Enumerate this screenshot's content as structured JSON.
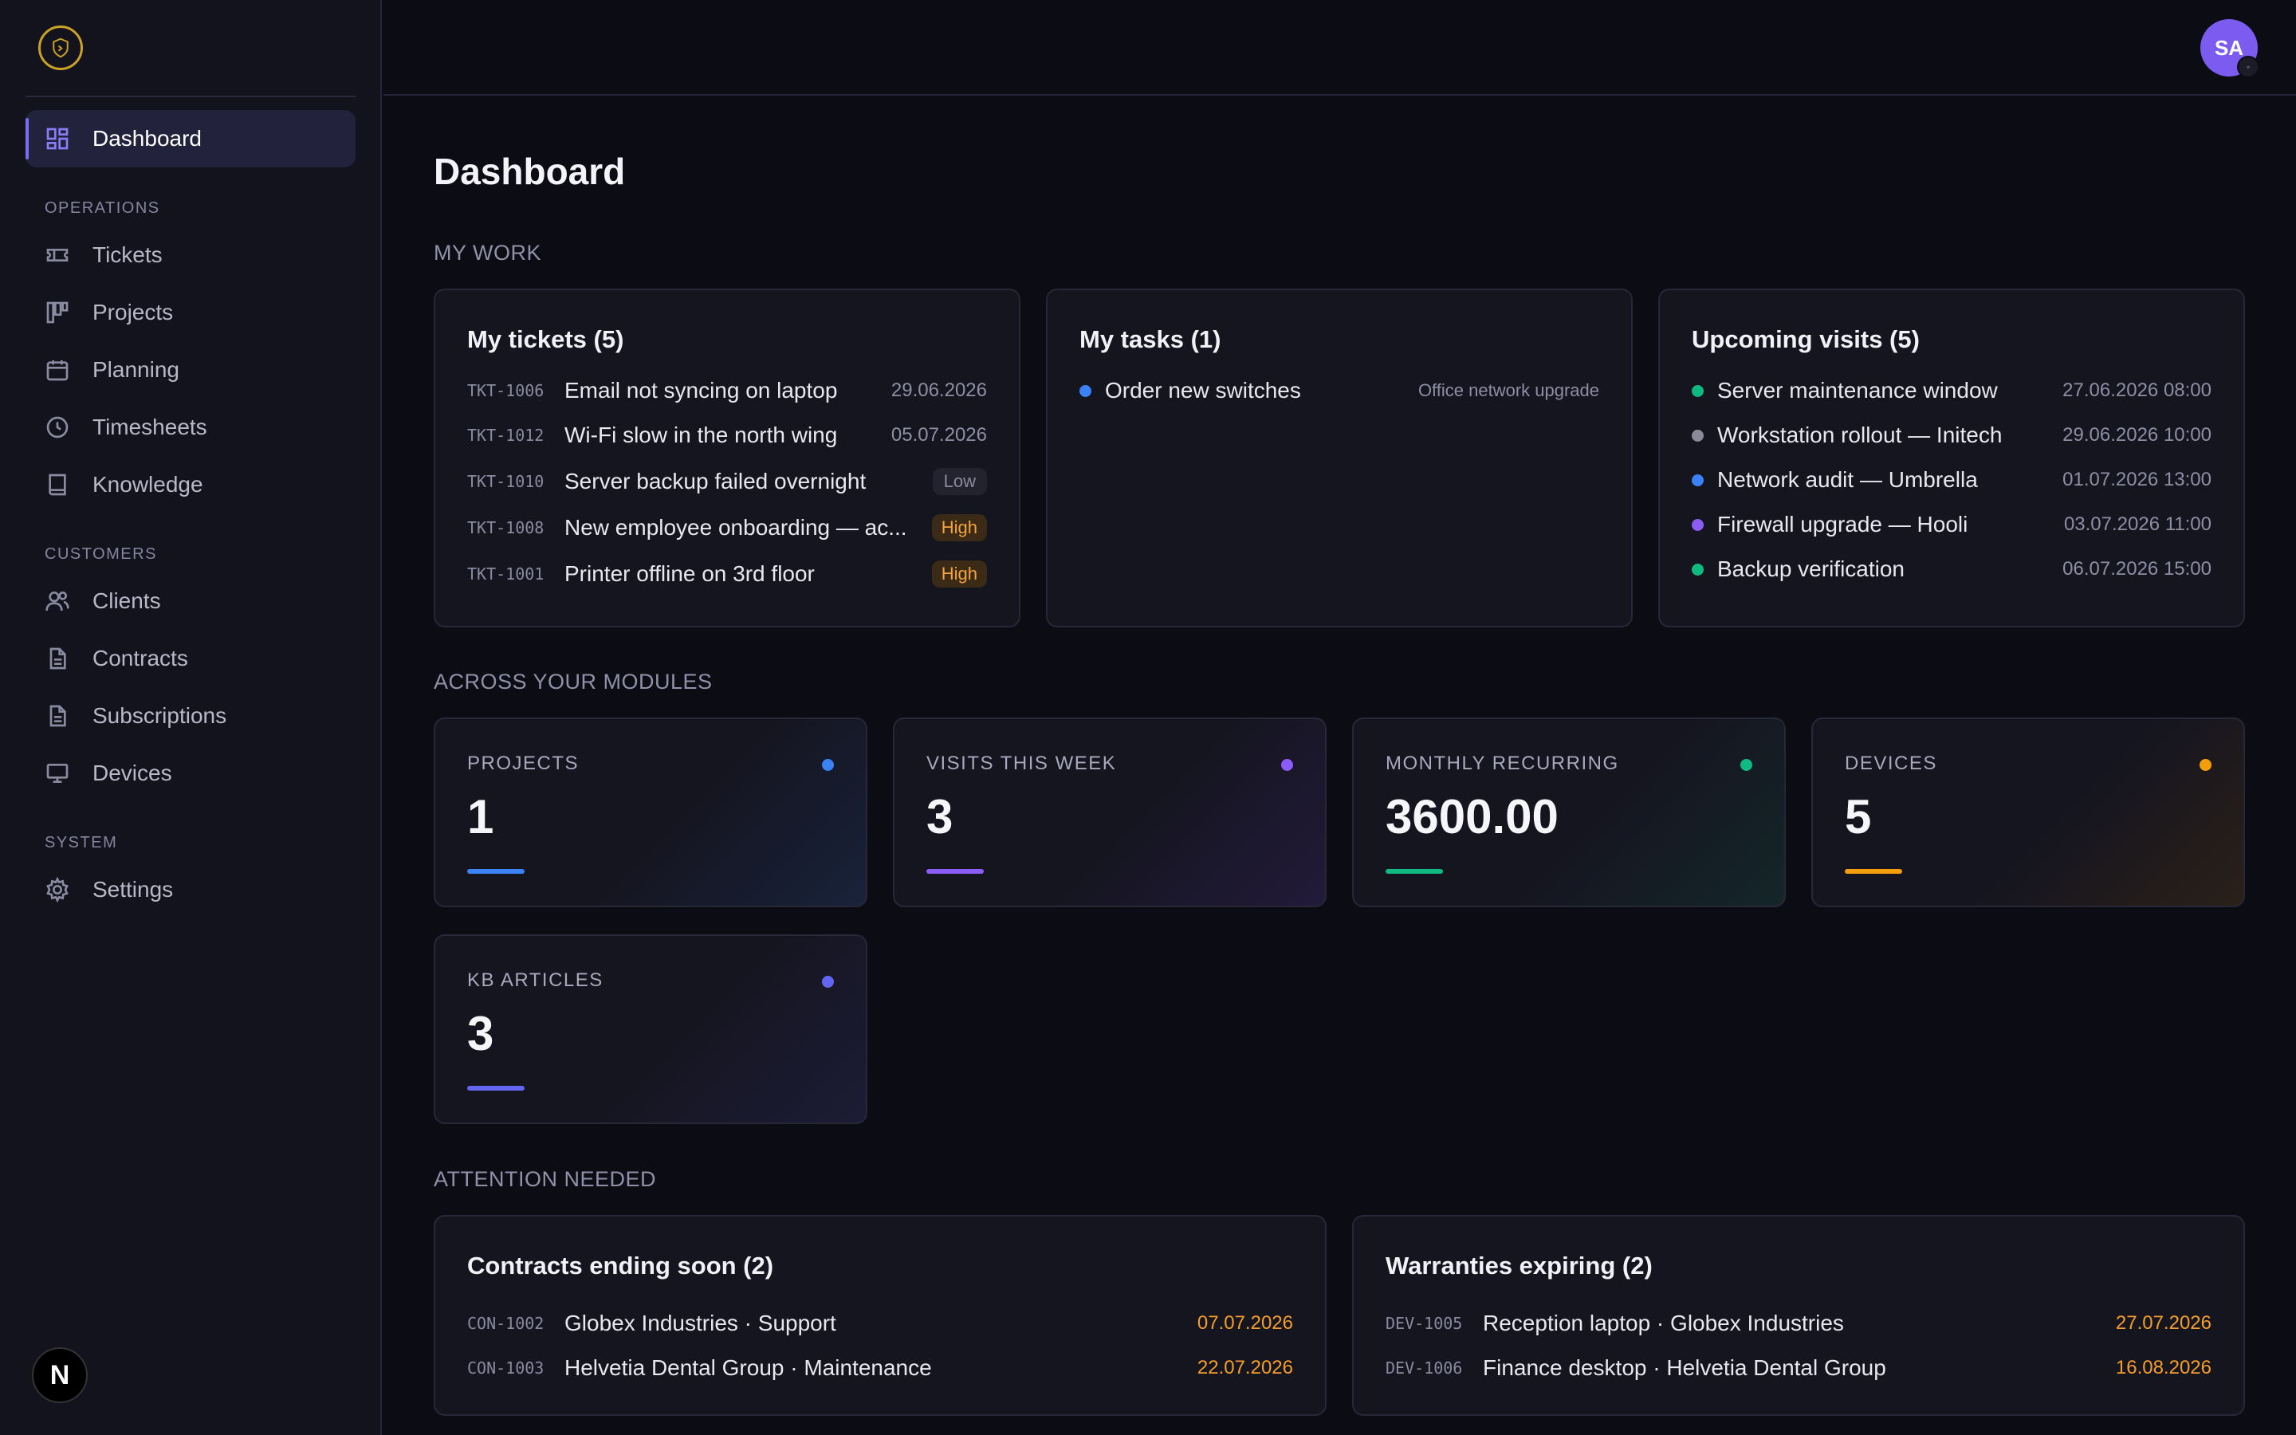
{
  "sidebar": {
    "active": {
      "label": "Dashboard",
      "icon": "dashboard-icon"
    },
    "sections": {
      "operations": "OPERATIONS",
      "customers": "CUSTOMERS",
      "system": "SYSTEM"
    },
    "items": {
      "tickets": "Tickets",
      "projects": "Projects",
      "planning": "Planning",
      "timesheets": "Timesheets",
      "knowledge": "Knowledge",
      "clients": "Clients",
      "contracts": "Contracts",
      "subscriptions": "Subscriptions",
      "devices": "Devices",
      "settings": "Settings"
    },
    "badge": "N"
  },
  "header": {
    "avatar_initials": "SA"
  },
  "page": {
    "title": "Dashboard",
    "sections": {
      "my_work": "MY WORK",
      "modules": "ACROSS YOUR MODULES",
      "attention": "ATTENTION NEEDED"
    }
  },
  "my_tickets": {
    "title": "My tickets (5)",
    "rows": [
      {
        "id": "TKT-1006",
        "text": "Email not syncing on laptop",
        "date": "29.06.2026"
      },
      {
        "id": "TKT-1012",
        "text": "Wi-Fi slow in the north wing",
        "date": "05.07.2026"
      },
      {
        "id": "TKT-1010",
        "text": "Server backup failed overnight",
        "priority": "Low"
      },
      {
        "id": "TKT-1008",
        "text": "New employee onboarding — ac...",
        "priority": "High"
      },
      {
        "id": "TKT-1001",
        "text": "Printer offline on 3rd floor",
        "priority": "High"
      }
    ]
  },
  "my_tasks": {
    "title": "My tasks (1)",
    "rows": [
      {
        "text": "Order new switches",
        "meta": "Office network upgrade",
        "color": "#3b82f6"
      }
    ]
  },
  "visits": {
    "title": "Upcoming visits (5)",
    "rows": [
      {
        "text": "Server maintenance window",
        "date": "27.06.2026 08:00",
        "color": "#10b981"
      },
      {
        "text": "Workstation rollout — Initech",
        "date": "29.06.2026 10:00",
        "color": "#8a8a9a"
      },
      {
        "text": "Network audit — Umbrella",
        "date": "01.07.2026 13:00",
        "color": "#3b82f6"
      },
      {
        "text": "Firewall upgrade — Hooli",
        "date": "03.07.2026 11:00",
        "color": "#8b5cf6"
      },
      {
        "text": "Backup verification",
        "date": "06.07.2026 15:00",
        "color": "#10b981"
      }
    ]
  },
  "stats": [
    {
      "label": "PROJECTS",
      "value": "1",
      "color": "#3b82f6"
    },
    {
      "label": "VISITS THIS WEEK",
      "value": "3",
      "color": "#8b5cf6"
    },
    {
      "label": "MONTHLY RECURRING",
      "value": "3600.00",
      "color": "#10b981"
    },
    {
      "label": "DEVICES",
      "value": "5",
      "color": "#f59e0b"
    },
    {
      "label": "KB ARTICLES",
      "value": "3",
      "color": "#6366f1"
    }
  ],
  "contracts": {
    "title": "Contracts ending soon (2)",
    "rows": [
      {
        "id": "CON-1002",
        "text": "Globex Industries · Support",
        "date": "07.07.2026"
      },
      {
        "id": "CON-1003",
        "text": "Helvetia Dental Group · Maintenance",
        "date": "22.07.2026"
      }
    ]
  },
  "warranties": {
    "title": "Warranties expiring (2)",
    "rows": [
      {
        "id": "DEV-1005",
        "text": "Reception laptop · Globex Industries",
        "date": "27.07.2026"
      },
      {
        "id": "DEV-1006",
        "text": "Finance desktop · Helvetia Dental Group",
        "date": "16.08.2026"
      }
    ]
  },
  "colors": {
    "accent": "#7b6cf6",
    "warning": "#f59e2b",
    "background": "#0c0c14"
  }
}
